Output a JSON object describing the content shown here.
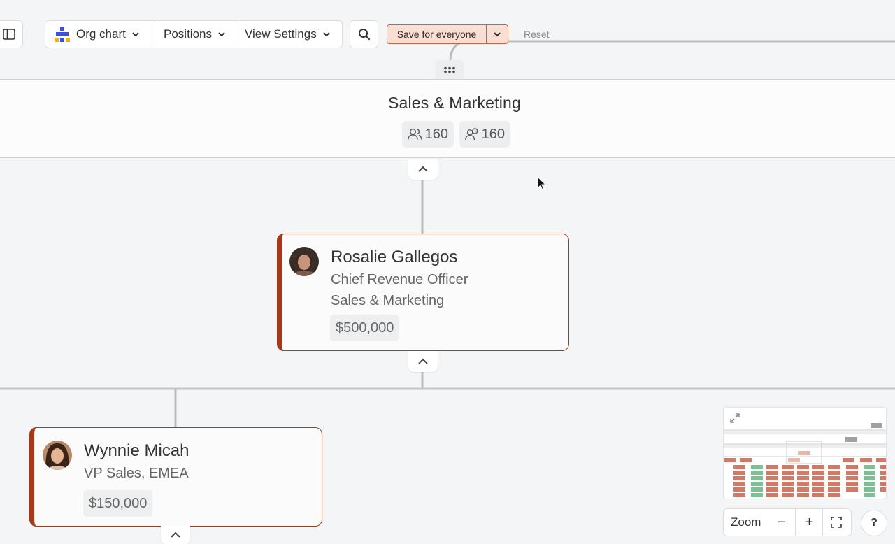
{
  "toolbar": {
    "org_chart_label": "Org chart",
    "positions_label": "Positions",
    "view_settings_label": "View Settings",
    "save_label": "Save for everyone",
    "reset_label": "Reset"
  },
  "department": {
    "name": "Sales & Marketing",
    "headcount": "160",
    "positions_count": "160"
  },
  "cards": [
    {
      "name": "Rosalie Gallegos",
      "title": "Chief Revenue Officer",
      "department": "Sales & Marketing",
      "salary": "$500,000"
    },
    {
      "name": "Wynnie Micah",
      "title": "VP Sales, EMEA",
      "salary": "$150,000"
    }
  ],
  "zoom": {
    "label": "Zoom",
    "minus": "−",
    "plus": "+"
  },
  "help_label": "?",
  "colors": {
    "accent": "#a33a1c",
    "save_bg": "#f8dfd3",
    "save_border": "#c9643a"
  }
}
